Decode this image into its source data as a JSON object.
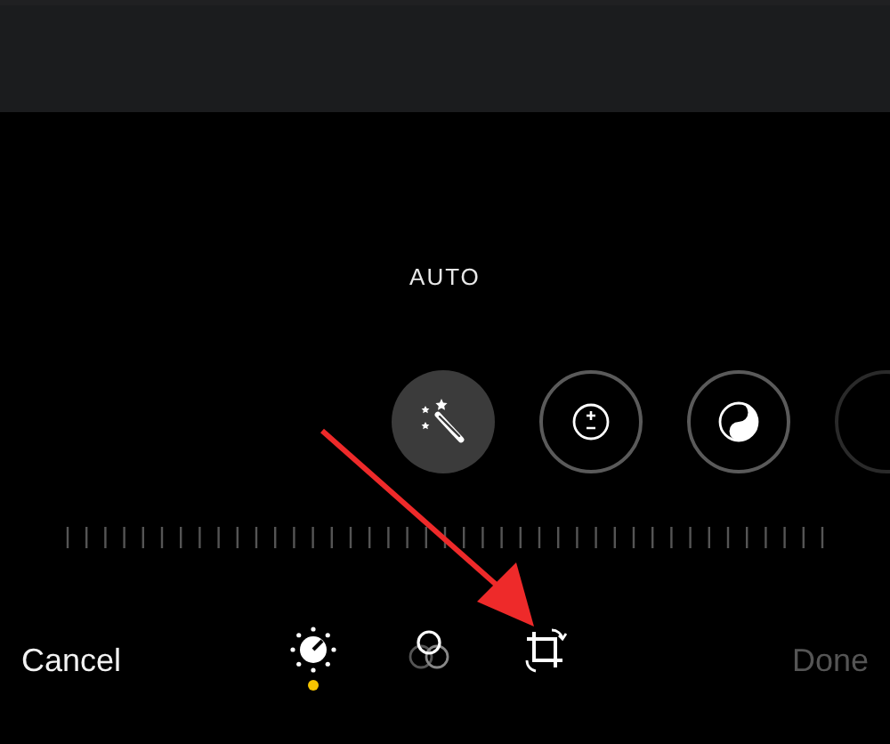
{
  "adjust_label": "AUTO",
  "tools": [
    {
      "kind": "auto",
      "selected": true
    },
    {
      "kind": "exposure",
      "selected": false
    },
    {
      "kind": "brilliance",
      "selected": false
    },
    {
      "kind": "partial",
      "selected": false
    }
  ],
  "cancel": "Cancel",
  "tabs": [
    {
      "kind": "adjust",
      "selected": true
    },
    {
      "kind": "filters",
      "selected": false
    },
    {
      "kind": "crop",
      "selected": false
    }
  ],
  "done": {
    "label": "Done",
    "disabled": true
  },
  "annotation": {
    "kind": "arrow",
    "color": "#ee2a2a"
  }
}
